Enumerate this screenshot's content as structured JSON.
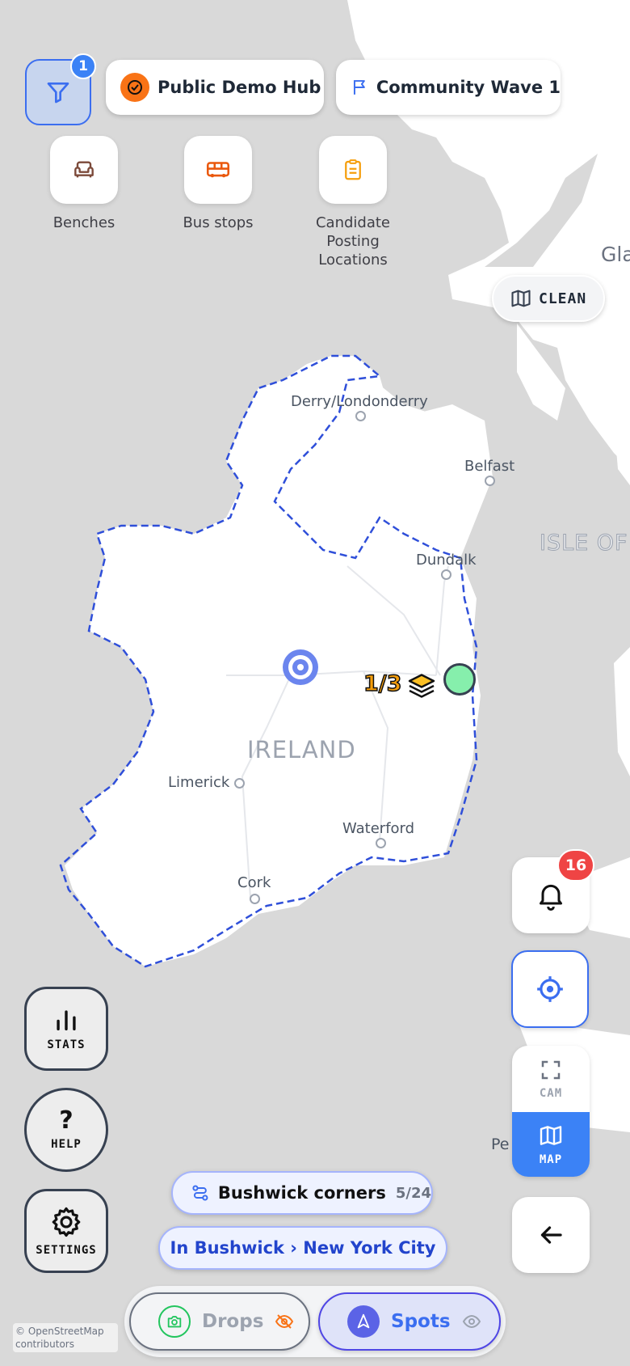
{
  "filters": {
    "badge_count": "1",
    "hub_chip": "Public Demo Hub",
    "wave_chip": "Community Wave 1"
  },
  "quick_layers": [
    {
      "label": "Benches",
      "icon": "armchair-icon"
    },
    {
      "label": "Bus stops",
      "icon": "bus-icon"
    },
    {
      "label": "Candidate Posting Locations",
      "icon": "clipboard-icon"
    }
  ],
  "map": {
    "style_button": "CLEAN",
    "cities": {
      "derry": "Derry/Londonderry",
      "belfast": "Belfast",
      "dundalk": "Dundalk",
      "limerick": "Limerick",
      "waterford": "Waterford",
      "cork": "Cork"
    },
    "country_label": "IRELAND",
    "sea_label": "ISLE OF",
    "edge_label_glasgow": "Gla",
    "edge_label_pe": "Pe",
    "cluster_count": "1/3",
    "attribution": "© OpenStreetMap contributors"
  },
  "left_controls": {
    "stats": "STATS",
    "help": "HELP",
    "settings": "SETTINGS"
  },
  "right_controls": {
    "notifications_badge": "16",
    "cam_label": "CAM",
    "map_label": "MAP"
  },
  "route": {
    "name": "Bushwick corners",
    "progress": "5/24",
    "location": "In Bushwick › New York City"
  },
  "tabs": {
    "drops": "Drops",
    "spots": "Spots"
  },
  "colors": {
    "accent": "#3b6ef0",
    "orange": "#f97316",
    "red_badge": "#ef4444",
    "green_marker": "#86efac",
    "border_dashed": "#2f4fd9"
  }
}
